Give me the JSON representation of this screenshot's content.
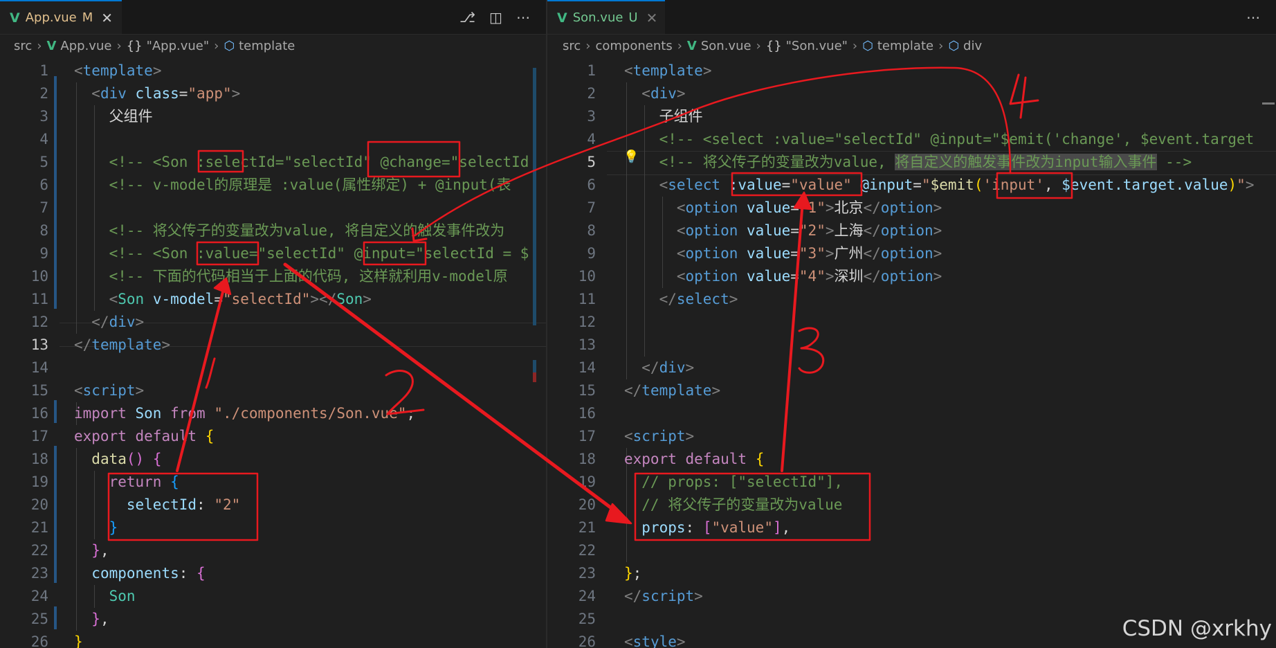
{
  "left_editor": {
    "tab": {
      "title": "App.vue",
      "status": "M",
      "vue_icon": "V",
      "close": "✕"
    },
    "actions": [
      "⎇",
      "◫",
      "⋯"
    ],
    "breadcrumb": [
      "src",
      "App.vue",
      "\"App.vue\"",
      "template"
    ],
    "current_line": 13,
    "lines": [
      {
        "n": 1,
        "segs": [
          [
            "p",
            "<"
          ],
          [
            "tag",
            "template"
          ],
          [
            "p",
            ">"
          ]
        ]
      },
      {
        "n": 2,
        "segs": [
          [
            "p",
            "  <"
          ],
          [
            "tag",
            "div"
          ],
          [
            "txt",
            " "
          ],
          [
            "attr",
            "class"
          ],
          [
            "txt",
            "="
          ],
          [
            "str",
            "\"app\""
          ],
          [
            "p",
            ">"
          ]
        ]
      },
      {
        "n": 3,
        "segs": [
          [
            "txt",
            "    父组件"
          ]
        ]
      },
      {
        "n": 4,
        "segs": []
      },
      {
        "n": 5,
        "segs": [
          [
            "cm",
            "    <!-- <Son :selectId=\"selectId\" @change=\"selectId"
          ]
        ]
      },
      {
        "n": 6,
        "segs": [
          [
            "cm",
            "    <!-- v-model的原理是 :value(属性绑定) + @input(表"
          ]
        ]
      },
      {
        "n": 7,
        "segs": []
      },
      {
        "n": 8,
        "segs": [
          [
            "cm",
            "    <!-- 将父传子的变量改为value, 将自定义的触发事件改为"
          ]
        ]
      },
      {
        "n": 9,
        "segs": [
          [
            "cm",
            "    <!-- <Son :value=\"selectId\" @input=\"selectId = $"
          ]
        ]
      },
      {
        "n": 10,
        "segs": [
          [
            "cm",
            "    <!-- 下面的代码相当于上面的代码, 这样就利用v-model原"
          ]
        ]
      },
      {
        "n": 11,
        "segs": [
          [
            "p",
            "    <"
          ],
          [
            "comp",
            "Son"
          ],
          [
            "txt",
            " "
          ],
          [
            "attr",
            "v-model"
          ],
          [
            "txt",
            "="
          ],
          [
            "str",
            "\"selectId\""
          ],
          [
            "p",
            "></"
          ],
          [
            "comp",
            "Son"
          ],
          [
            "p",
            ">"
          ]
        ]
      },
      {
        "n": 12,
        "segs": [
          [
            "p",
            "  </"
          ],
          [
            "tag",
            "div"
          ],
          [
            "p",
            ">"
          ]
        ]
      },
      {
        "n": 13,
        "segs": [
          [
            "p",
            "</"
          ],
          [
            "tag",
            "template"
          ],
          [
            "p",
            ">"
          ]
        ]
      },
      {
        "n": 14,
        "segs": []
      },
      {
        "n": 15,
        "segs": [
          [
            "p",
            "<"
          ],
          [
            "tag",
            "script"
          ],
          [
            "p",
            ">"
          ]
        ]
      },
      {
        "n": 16,
        "segs": [
          [
            "kw",
            "import"
          ],
          [
            "txt",
            " "
          ],
          [
            "attr",
            "Son"
          ],
          [
            "txt",
            " "
          ],
          [
            "kw",
            "from"
          ],
          [
            "txt",
            " "
          ],
          [
            "str",
            "\"./components/Son.vue\""
          ],
          [
            "txt",
            ";"
          ]
        ]
      },
      {
        "n": 17,
        "segs": [
          [
            "kw",
            "export"
          ],
          [
            "txt",
            " "
          ],
          [
            "kw",
            "default"
          ],
          [
            "txt",
            " "
          ],
          [
            "b1",
            "{"
          ]
        ]
      },
      {
        "n": 18,
        "segs": [
          [
            "txt",
            "  "
          ],
          [
            "fn",
            "data"
          ],
          [
            "b2",
            "()"
          ],
          [
            "txt",
            " "
          ],
          [
            "b2",
            "{"
          ]
        ]
      },
      {
        "n": 19,
        "segs": [
          [
            "txt",
            "    "
          ],
          [
            "kw",
            "return"
          ],
          [
            "txt",
            " "
          ],
          [
            "b3",
            "{"
          ]
        ]
      },
      {
        "n": 20,
        "segs": [
          [
            "txt",
            "      "
          ],
          [
            "attr",
            "selectId"
          ],
          [
            "txt",
            ": "
          ],
          [
            "str",
            "\"2\""
          ]
        ]
      },
      {
        "n": 21,
        "segs": [
          [
            "txt",
            "    "
          ],
          [
            "b3",
            "}"
          ]
        ]
      },
      {
        "n": 22,
        "segs": [
          [
            "txt",
            "  "
          ],
          [
            "b2",
            "}"
          ],
          [
            "txt",
            ","
          ]
        ]
      },
      {
        "n": 23,
        "segs": [
          [
            "txt",
            "  "
          ],
          [
            "attr",
            "components"
          ],
          [
            "txt",
            ": "
          ],
          [
            "b2",
            "{"
          ]
        ]
      },
      {
        "n": 24,
        "segs": [
          [
            "txt",
            "    "
          ],
          [
            "comp",
            "Son"
          ]
        ]
      },
      {
        "n": 25,
        "segs": [
          [
            "txt",
            "  "
          ],
          [
            "b2",
            "}"
          ],
          [
            "txt",
            ","
          ]
        ]
      },
      {
        "n": 26,
        "segs": [
          [
            "b1",
            "}"
          ]
        ]
      }
    ]
  },
  "right_editor": {
    "tab": {
      "title": "Son.vue",
      "status": "U",
      "vue_icon": "V",
      "close": "✕"
    },
    "actions": [
      "⋯"
    ],
    "breadcrumb": [
      "src",
      "components",
      "Son.vue",
      "\"Son.vue\"",
      "template",
      "div"
    ],
    "current_line": 5,
    "lines": [
      {
        "n": 1,
        "segs": [
          [
            "p",
            "<"
          ],
          [
            "tag",
            "template"
          ],
          [
            "p",
            ">"
          ]
        ]
      },
      {
        "n": 2,
        "segs": [
          [
            "p",
            "  <"
          ],
          [
            "tag",
            "div"
          ],
          [
            "p",
            ">"
          ]
        ]
      },
      {
        "n": 3,
        "segs": [
          [
            "txt",
            "    子组件"
          ]
        ]
      },
      {
        "n": 4,
        "segs": [
          [
            "cm",
            "    <!-- <select :value=\"selectId\" @input=\"$emit('change', $event.target"
          ]
        ]
      },
      {
        "n": 5,
        "segs": [
          [
            "cm",
            "    <!-- 将父传子的变量改为value, "
          ],
          [
            "cmhl",
            "将自定义的触发事件改为input输入事件"
          ],
          [
            "cm",
            " -->"
          ]
        ]
      },
      {
        "n": 6,
        "segs": [
          [
            "p",
            "    <"
          ],
          [
            "tag",
            "select"
          ],
          [
            "txt",
            " "
          ],
          [
            "attr",
            ":value"
          ],
          [
            "txt",
            "="
          ],
          [
            "str",
            "\"value\""
          ],
          [
            "txt",
            " "
          ],
          [
            "attr",
            "@input"
          ],
          [
            "txt",
            "="
          ],
          [
            "str",
            "\""
          ],
          [
            "fn",
            "$emit"
          ],
          [
            "b1",
            "("
          ],
          [
            "str",
            "'input'"
          ],
          [
            "txt",
            ", "
          ],
          [
            "attr",
            "$event.target.value"
          ],
          [
            "b1",
            ")"
          ],
          [
            "str",
            "\""
          ],
          [
            "p",
            ">"
          ]
        ]
      },
      {
        "n": 7,
        "segs": [
          [
            "p",
            "      <"
          ],
          [
            "tag",
            "option"
          ],
          [
            "txt",
            " "
          ],
          [
            "attr",
            "value"
          ],
          [
            "txt",
            "="
          ],
          [
            "str",
            "\"1\""
          ],
          [
            "p",
            ">"
          ],
          [
            "txt",
            "北京"
          ],
          [
            "p",
            "</"
          ],
          [
            "tag",
            "option"
          ],
          [
            "p",
            ">"
          ]
        ]
      },
      {
        "n": 8,
        "segs": [
          [
            "p",
            "      <"
          ],
          [
            "tag",
            "option"
          ],
          [
            "txt",
            " "
          ],
          [
            "attr",
            "value"
          ],
          [
            "txt",
            "="
          ],
          [
            "str",
            "\"2\""
          ],
          [
            "p",
            ">"
          ],
          [
            "txt",
            "上海"
          ],
          [
            "p",
            "</"
          ],
          [
            "tag",
            "option"
          ],
          [
            "p",
            ">"
          ]
        ]
      },
      {
        "n": 9,
        "segs": [
          [
            "p",
            "      <"
          ],
          [
            "tag",
            "option"
          ],
          [
            "txt",
            " "
          ],
          [
            "attr",
            "value"
          ],
          [
            "txt",
            "="
          ],
          [
            "str",
            "\"3\""
          ],
          [
            "p",
            ">"
          ],
          [
            "txt",
            "广州"
          ],
          [
            "p",
            "</"
          ],
          [
            "tag",
            "option"
          ],
          [
            "p",
            ">"
          ]
        ]
      },
      {
        "n": 10,
        "segs": [
          [
            "p",
            "      <"
          ],
          [
            "tag",
            "option"
          ],
          [
            "txt",
            " "
          ],
          [
            "attr",
            "value"
          ],
          [
            "txt",
            "="
          ],
          [
            "str",
            "\"4\""
          ],
          [
            "p",
            ">"
          ],
          [
            "txt",
            "深圳"
          ],
          [
            "p",
            "</"
          ],
          [
            "tag",
            "option"
          ],
          [
            "p",
            ">"
          ]
        ]
      },
      {
        "n": 11,
        "segs": [
          [
            "p",
            "    </"
          ],
          [
            "tag",
            "select"
          ],
          [
            "p",
            ">"
          ]
        ]
      },
      {
        "n": 12,
        "segs": []
      },
      {
        "n": 13,
        "segs": []
      },
      {
        "n": 14,
        "segs": [
          [
            "p",
            "  </"
          ],
          [
            "tag",
            "div"
          ],
          [
            "p",
            ">"
          ]
        ]
      },
      {
        "n": 15,
        "segs": [
          [
            "p",
            "</"
          ],
          [
            "tag",
            "template"
          ],
          [
            "p",
            ">"
          ]
        ]
      },
      {
        "n": 16,
        "segs": []
      },
      {
        "n": 17,
        "segs": [
          [
            "p",
            "<"
          ],
          [
            "tag",
            "script"
          ],
          [
            "p",
            ">"
          ]
        ]
      },
      {
        "n": 18,
        "segs": [
          [
            "kw",
            "export"
          ],
          [
            "txt",
            " "
          ],
          [
            "kw",
            "default"
          ],
          [
            "txt",
            " "
          ],
          [
            "b1",
            "{"
          ]
        ]
      },
      {
        "n": 19,
        "segs": [
          [
            "cm",
            "  // props: [\"selectId\"],"
          ]
        ]
      },
      {
        "n": 20,
        "segs": [
          [
            "cm",
            "  // 将父传子的变量改为value"
          ]
        ]
      },
      {
        "n": 21,
        "segs": [
          [
            "txt",
            "  "
          ],
          [
            "attr",
            "props"
          ],
          [
            "txt",
            ": "
          ],
          [
            "b2",
            "["
          ],
          [
            "str",
            "\"value\""
          ],
          [
            "b2",
            "]"
          ],
          [
            "txt",
            ","
          ]
        ]
      },
      {
        "n": 22,
        "segs": []
      },
      {
        "n": 23,
        "segs": [
          [
            "b1",
            "}"
          ],
          [
            "txt",
            ";"
          ]
        ]
      },
      {
        "n": 24,
        "segs": [
          [
            "p",
            "</"
          ],
          [
            "tag",
            "script"
          ],
          [
            "p",
            ">"
          ]
        ]
      },
      {
        "n": 25,
        "segs": []
      },
      {
        "n": 26,
        "segs": [
          [
            "p",
            "<"
          ],
          [
            "tag",
            "style"
          ],
          [
            "p",
            ">"
          ]
        ]
      }
    ]
  },
  "annotations": {
    "labels": [
      "1",
      "2",
      "3",
      "4"
    ],
    "color": "#e8191f"
  },
  "watermark": "CSDN @xrkhy"
}
